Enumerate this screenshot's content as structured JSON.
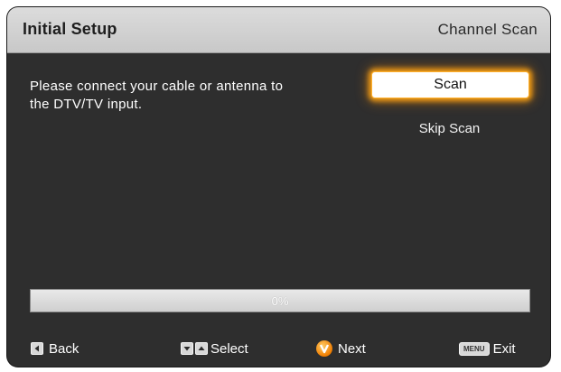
{
  "header": {
    "title": "Initial Setup",
    "section": "Channel Scan"
  },
  "message": "Please connect your cable or antenna to the DTV/TV input.",
  "actions": {
    "scan_label": "Scan",
    "skip_label": "Skip Scan"
  },
  "progress": {
    "label": "0%",
    "fraction": 0.0
  },
  "footer": {
    "back_label": "Back",
    "select_label": "Select",
    "next_label": "Next",
    "menu_key_label": "MENU",
    "exit_label": "Exit"
  },
  "colors": {
    "accent": "#f5a000",
    "panel_bg": "#2e2e2e",
    "title_bar": "#d3d3d3"
  },
  "icons": {
    "back": "left-arrow-key-icon",
    "select": [
      "down-arrow-key-icon",
      "up-arrow-key-icon"
    ],
    "next": "v-button-icon",
    "exit": "menu-key-icon"
  }
}
